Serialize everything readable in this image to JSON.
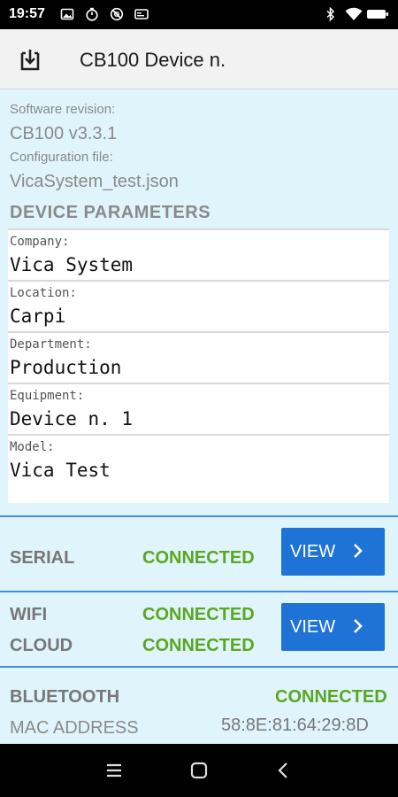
{
  "status_bar": {
    "time": "19:57",
    "left_icons": [
      "image-icon",
      "timer-icon",
      "at-sign-icon",
      "card-icon"
    ],
    "right_icons": [
      "bluetooth-icon",
      "wifi-icon",
      "battery-icon"
    ]
  },
  "app_bar": {
    "title": "CB100 Device n.",
    "action_icon": "download-icon"
  },
  "info": {
    "software_label": "Software revision:",
    "software_value": "CB100 v3.3.1",
    "config_label": "Configuration file:",
    "config_value": "VicaSystem_test.json"
  },
  "params": {
    "title": "DEVICE PARAMETERS",
    "items": [
      {
        "label": "Company:",
        "value": "Vica System"
      },
      {
        "label": "Location:",
        "value": "Carpi"
      },
      {
        "label": "Department:",
        "value": "Production"
      },
      {
        "label": "Equipment:",
        "value": "Device n. 1"
      },
      {
        "label": "Model:",
        "value": "Vica Test"
      }
    ]
  },
  "serial": {
    "label": "SERIAL",
    "status": "CONNECTED",
    "button": "VIEW"
  },
  "wifi": {
    "label": "WIFI",
    "status": "CONNECTED",
    "cloud_label": "CLOUD",
    "cloud_status": "CONNECTED",
    "button": "VIEW"
  },
  "bluetooth": {
    "label": "BLUETOOTH",
    "status": "CONNECTED",
    "mac_label": "MAC ADDRESS",
    "mac_value": "58:8E:81:64:29:8D"
  },
  "colors": {
    "background": "#dff4fb",
    "accent_blue": "#1f73d6",
    "connected_green": "#5aa822",
    "divider_blue": "#3d8ee6"
  },
  "nav_bar": {
    "icons": [
      "menu-icon",
      "home-icon",
      "back-icon"
    ]
  }
}
